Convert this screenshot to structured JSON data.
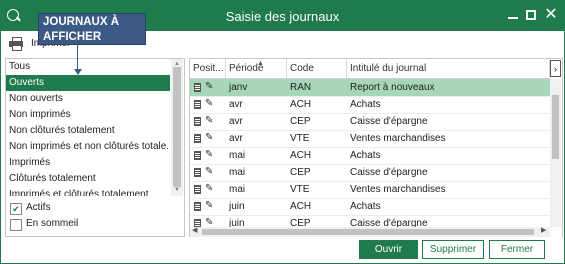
{
  "window": {
    "title": "Saisie des journaux"
  },
  "toolbar": {
    "print_label": "Imprimer"
  },
  "callout": {
    "line1": "JOURNAUX À",
    "line2": "AFFICHER"
  },
  "filters": [
    {
      "label": "Tous",
      "selected": false
    },
    {
      "label": "Ouverts",
      "selected": true
    },
    {
      "label": "Non ouverts",
      "selected": false
    },
    {
      "label": "Non imprimés",
      "selected": false
    },
    {
      "label": "Non clôturés totalement",
      "selected": false
    },
    {
      "label": "Non imprimés et non clôturés totale...",
      "selected": false
    },
    {
      "label": "Imprimés",
      "selected": false
    },
    {
      "label": "Clôturés totalement",
      "selected": false
    },
    {
      "label": "Imprimés et clôturés totalement",
      "selected": false
    }
  ],
  "options": {
    "actifs": {
      "label": "Actifs",
      "checked": true
    },
    "sommeil": {
      "label": "En sommeil",
      "checked": false
    }
  },
  "grid": {
    "columns": [
      "Posit...",
      "Période",
      "Code",
      "Intitulé du journal"
    ],
    "rows": [
      {
        "periode": "janv",
        "code": "RAN",
        "intitule": "Report à nouveaux",
        "selected": true
      },
      {
        "periode": "avr",
        "code": "ACH",
        "intitule": "Achats",
        "selected": false
      },
      {
        "periode": "avr",
        "code": "CEP",
        "intitule": "Caisse d'épargne",
        "selected": false
      },
      {
        "periode": "avr",
        "code": "VTE",
        "intitule": "Ventes marchandises",
        "selected": false
      },
      {
        "periode": "mai",
        "code": "ACH",
        "intitule": "Achats",
        "selected": false
      },
      {
        "periode": "mai",
        "code": "CEP",
        "intitule": "Caisse d'épargne",
        "selected": false
      },
      {
        "periode": "mai",
        "code": "VTE",
        "intitule": "Ventes marchandises",
        "selected": false
      },
      {
        "periode": "juin",
        "code": "ACH",
        "intitule": "Achats",
        "selected": false
      },
      {
        "periode": "juin",
        "code": "CEP",
        "intitule": "Caisse d'épargne",
        "selected": false
      }
    ]
  },
  "buttons": {
    "ouvrir": "Ouvrir",
    "supprimer": "Supprimer",
    "fermer": "Fermer"
  },
  "colors": {
    "accent": "#1f7a4d",
    "row_highlight": "#a7d6b9",
    "callout_bg": "#3c5a86"
  }
}
